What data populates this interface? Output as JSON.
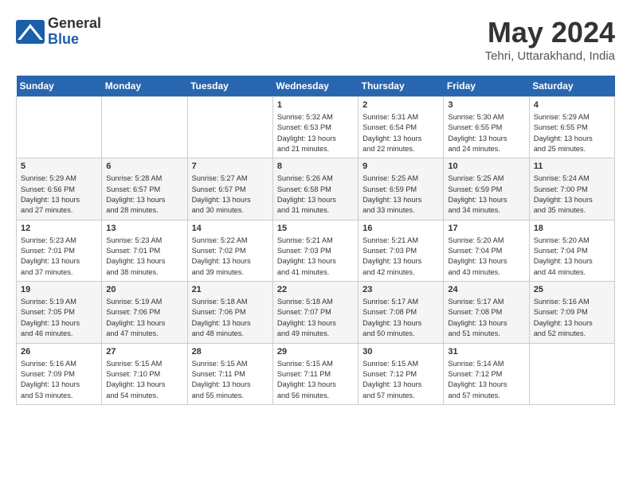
{
  "header": {
    "logo_line1": "General",
    "logo_line2": "Blue",
    "month": "May 2024",
    "location": "Tehri, Uttarakhand, India"
  },
  "weekdays": [
    "Sunday",
    "Monday",
    "Tuesday",
    "Wednesday",
    "Thursday",
    "Friday",
    "Saturday"
  ],
  "weeks": [
    [
      {
        "day": "",
        "info": ""
      },
      {
        "day": "",
        "info": ""
      },
      {
        "day": "",
        "info": ""
      },
      {
        "day": "1",
        "info": "Sunrise: 5:32 AM\nSunset: 6:53 PM\nDaylight: 13 hours\nand 21 minutes."
      },
      {
        "day": "2",
        "info": "Sunrise: 5:31 AM\nSunset: 6:54 PM\nDaylight: 13 hours\nand 22 minutes."
      },
      {
        "day": "3",
        "info": "Sunrise: 5:30 AM\nSunset: 6:55 PM\nDaylight: 13 hours\nand 24 minutes."
      },
      {
        "day": "4",
        "info": "Sunrise: 5:29 AM\nSunset: 6:55 PM\nDaylight: 13 hours\nand 25 minutes."
      }
    ],
    [
      {
        "day": "5",
        "info": "Sunrise: 5:29 AM\nSunset: 6:56 PM\nDaylight: 13 hours\nand 27 minutes."
      },
      {
        "day": "6",
        "info": "Sunrise: 5:28 AM\nSunset: 6:57 PM\nDaylight: 13 hours\nand 28 minutes."
      },
      {
        "day": "7",
        "info": "Sunrise: 5:27 AM\nSunset: 6:57 PM\nDaylight: 13 hours\nand 30 minutes."
      },
      {
        "day": "8",
        "info": "Sunrise: 5:26 AM\nSunset: 6:58 PM\nDaylight: 13 hours\nand 31 minutes."
      },
      {
        "day": "9",
        "info": "Sunrise: 5:25 AM\nSunset: 6:59 PM\nDaylight: 13 hours\nand 33 minutes."
      },
      {
        "day": "10",
        "info": "Sunrise: 5:25 AM\nSunset: 6:59 PM\nDaylight: 13 hours\nand 34 minutes."
      },
      {
        "day": "11",
        "info": "Sunrise: 5:24 AM\nSunset: 7:00 PM\nDaylight: 13 hours\nand 35 minutes."
      }
    ],
    [
      {
        "day": "12",
        "info": "Sunrise: 5:23 AM\nSunset: 7:01 PM\nDaylight: 13 hours\nand 37 minutes."
      },
      {
        "day": "13",
        "info": "Sunrise: 5:23 AM\nSunset: 7:01 PM\nDaylight: 13 hours\nand 38 minutes."
      },
      {
        "day": "14",
        "info": "Sunrise: 5:22 AM\nSunset: 7:02 PM\nDaylight: 13 hours\nand 39 minutes."
      },
      {
        "day": "15",
        "info": "Sunrise: 5:21 AM\nSunset: 7:03 PM\nDaylight: 13 hours\nand 41 minutes."
      },
      {
        "day": "16",
        "info": "Sunrise: 5:21 AM\nSunset: 7:03 PM\nDaylight: 13 hours\nand 42 minutes."
      },
      {
        "day": "17",
        "info": "Sunrise: 5:20 AM\nSunset: 7:04 PM\nDaylight: 13 hours\nand 43 minutes."
      },
      {
        "day": "18",
        "info": "Sunrise: 5:20 AM\nSunset: 7:04 PM\nDaylight: 13 hours\nand 44 minutes."
      }
    ],
    [
      {
        "day": "19",
        "info": "Sunrise: 5:19 AM\nSunset: 7:05 PM\nDaylight: 13 hours\nand 46 minutes."
      },
      {
        "day": "20",
        "info": "Sunrise: 5:19 AM\nSunset: 7:06 PM\nDaylight: 13 hours\nand 47 minutes."
      },
      {
        "day": "21",
        "info": "Sunrise: 5:18 AM\nSunset: 7:06 PM\nDaylight: 13 hours\nand 48 minutes."
      },
      {
        "day": "22",
        "info": "Sunrise: 5:18 AM\nSunset: 7:07 PM\nDaylight: 13 hours\nand 49 minutes."
      },
      {
        "day": "23",
        "info": "Sunrise: 5:17 AM\nSunset: 7:08 PM\nDaylight: 13 hours\nand 50 minutes."
      },
      {
        "day": "24",
        "info": "Sunrise: 5:17 AM\nSunset: 7:08 PM\nDaylight: 13 hours\nand 51 minutes."
      },
      {
        "day": "25",
        "info": "Sunrise: 5:16 AM\nSunset: 7:09 PM\nDaylight: 13 hours\nand 52 minutes."
      }
    ],
    [
      {
        "day": "26",
        "info": "Sunrise: 5:16 AM\nSunset: 7:09 PM\nDaylight: 13 hours\nand 53 minutes."
      },
      {
        "day": "27",
        "info": "Sunrise: 5:15 AM\nSunset: 7:10 PM\nDaylight: 13 hours\nand 54 minutes."
      },
      {
        "day": "28",
        "info": "Sunrise: 5:15 AM\nSunset: 7:11 PM\nDaylight: 13 hours\nand 55 minutes."
      },
      {
        "day": "29",
        "info": "Sunrise: 5:15 AM\nSunset: 7:11 PM\nDaylight: 13 hours\nand 56 minutes."
      },
      {
        "day": "30",
        "info": "Sunrise: 5:15 AM\nSunset: 7:12 PM\nDaylight: 13 hours\nand 57 minutes."
      },
      {
        "day": "31",
        "info": "Sunrise: 5:14 AM\nSunset: 7:12 PM\nDaylight: 13 hours\nand 57 minutes."
      },
      {
        "day": "",
        "info": ""
      }
    ]
  ]
}
